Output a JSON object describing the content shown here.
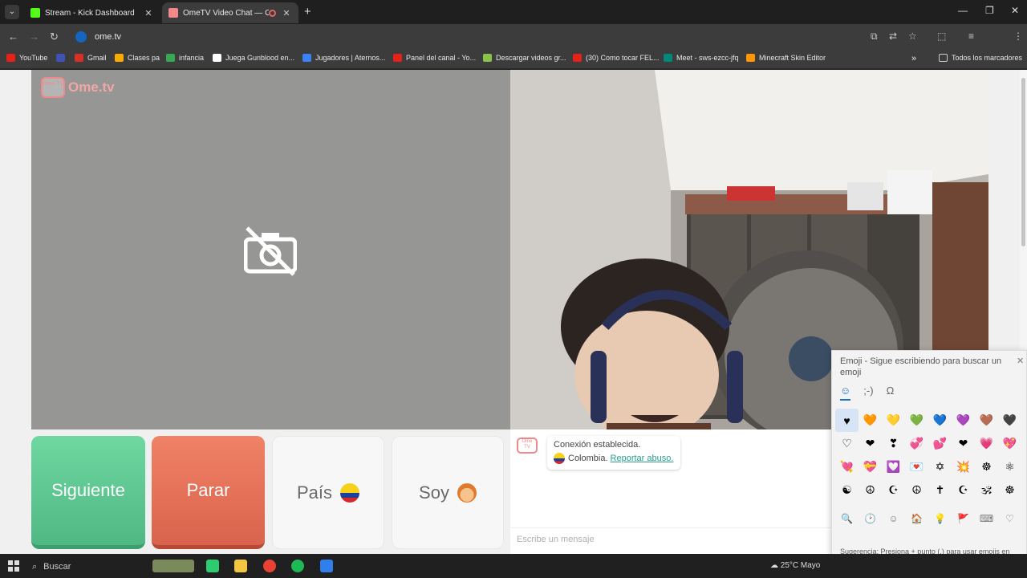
{
  "browser": {
    "tabs": [
      {
        "label": "Stream - Kick Dashboard",
        "favicon": "kick-icon"
      },
      {
        "label": "OmeTV Video Chat — Ome",
        "favicon": "ometv-icon"
      }
    ],
    "url": "ome.tv",
    "profile_initial": "T"
  },
  "bookmarks": [
    {
      "label": "YouTube",
      "color": "#e62117"
    },
    {
      "label": "",
      "color": "#3f51b5"
    },
    {
      "label": "Gmail",
      "color": "#d93025"
    },
    {
      "label": "Clases pa",
      "color": "#f9ab00"
    },
    {
      "label": "infancia",
      "color": "#34a853"
    },
    {
      "label": "Juega Gunblood en...",
      "color": "#ffffff"
    },
    {
      "label": "Jugadores | Aternos...",
      "color": "#3b82f6"
    },
    {
      "label": "Panel del canal - Yo...",
      "color": "#e62117"
    },
    {
      "label": "Descargar videos gr...",
      "color": "#8bc34a"
    },
    {
      "label": "(30) Como tocar FEL...",
      "color": "#e62117"
    },
    {
      "label": "Meet - sws-ezcc-jfq",
      "color": "#00897b"
    },
    {
      "label": "Minecraft Skin Editor",
      "color": "#ff9800"
    }
  ],
  "bookmarks_all": "Todos los marcadores",
  "ometv": {
    "logo_text": "Ome.tv",
    "logo_badge": "Ome TV",
    "buttons": {
      "next": "Siguiente",
      "stop": "Parar",
      "country": "País",
      "gender": "Soy"
    },
    "chat": {
      "connection": "Conexión establecida.",
      "country": "Colombia.",
      "report": "Reportar abuso.",
      "placeholder": "Escribe un mensaje"
    }
  },
  "emoji_panel": {
    "title": "Emoji - Sigue escribiendo para buscar un emoji",
    "tabs": [
      "☺",
      ";-)",
      "Ω"
    ],
    "grid": [
      "♥",
      "🧡",
      "💛",
      "💚",
      "💙",
      "💜",
      "🤎",
      "🖤",
      "♡",
      "❤",
      "❣",
      "💞",
      "💕",
      "❤",
      "💗",
      "💖",
      "💘",
      "💝",
      "💟",
      "💌",
      "✡",
      "💥",
      "☸",
      "⚛",
      "☯",
      "☮",
      "☪",
      "☮",
      "✝",
      "☪",
      "🕉",
      "☸"
    ],
    "bottom": [
      "🔍",
      "🕑",
      "☺",
      "🏠",
      "💡",
      "🚩",
      "⌨",
      "♡"
    ],
    "hint": "Sugerencia: Presiona  + punto (.) para usar emojis en cualquier aplicación"
  },
  "taskbar": {
    "search": "Buscar",
    "weather": "25°C  Mayo"
  }
}
